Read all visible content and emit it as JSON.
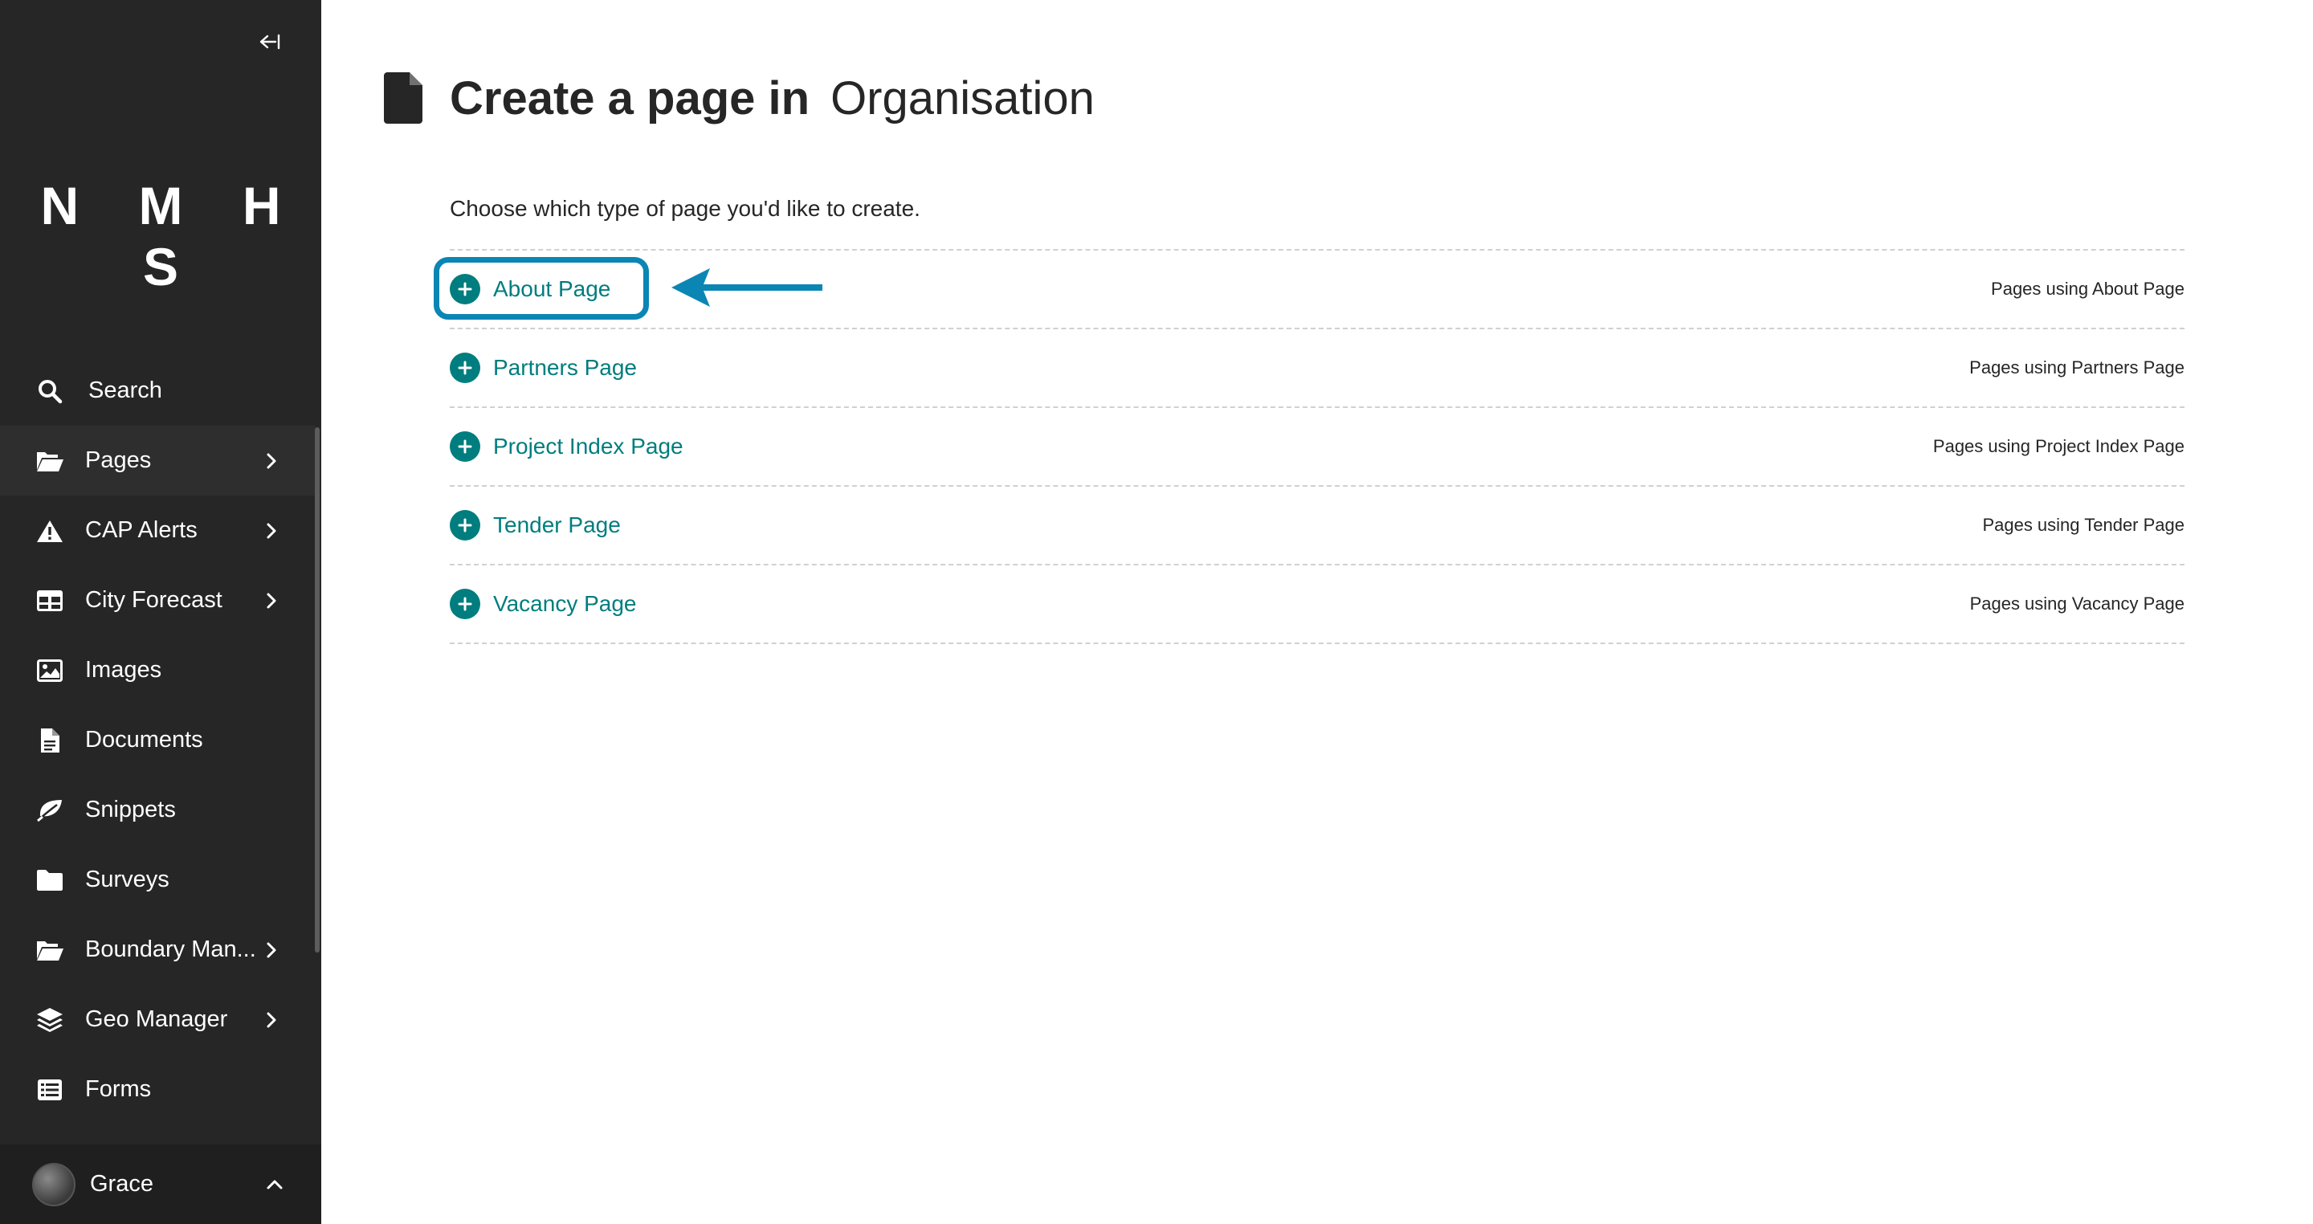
{
  "sidebar": {
    "logo": "N M H S",
    "nav": [
      {
        "label": "Search",
        "icon": "search-icon",
        "has_submenu": false
      },
      {
        "label": "Pages",
        "icon": "folder-open-icon",
        "has_submenu": true,
        "active": true
      },
      {
        "label": "CAP Alerts",
        "icon": "warning-icon",
        "has_submenu": true
      },
      {
        "label": "City Forecast",
        "icon": "table-icon",
        "has_submenu": true
      },
      {
        "label": "Images",
        "icon": "image-icon",
        "has_submenu": false
      },
      {
        "label": "Documents",
        "icon": "document-icon",
        "has_submenu": false
      },
      {
        "label": "Snippets",
        "icon": "leaf-icon",
        "has_submenu": false
      },
      {
        "label": "Surveys",
        "icon": "folder-icon",
        "has_submenu": false
      },
      {
        "label": "Boundary Man...",
        "icon": "folder-open-icon",
        "has_submenu": true
      },
      {
        "label": "Geo Manager",
        "icon": "layers-icon",
        "has_submenu": true
      },
      {
        "label": "Forms",
        "icon": "list-icon",
        "has_submenu": false
      }
    ],
    "account": {
      "name": "Grace"
    }
  },
  "header": {
    "title_bold": "Create a page in",
    "title_parent": "Organisation",
    "icon": "document-icon"
  },
  "main": {
    "intro": "Choose which type of page you'd like to create.",
    "page_types": [
      {
        "label": "About Page",
        "usage": "Pages using About Page",
        "highlighted": true
      },
      {
        "label": "Partners Page",
        "usage": "Pages using Partners Page"
      },
      {
        "label": "Project Index Page",
        "usage": "Pages using Project Index Page"
      },
      {
        "label": "Tender Page",
        "usage": "Pages using Tender Page"
      },
      {
        "label": "Vacancy Page",
        "usage": "Pages using Vacancy Page"
      }
    ]
  },
  "colors": {
    "sidebar_bg": "#262626",
    "accent_teal": "#007d7e",
    "annotation_blue": "#0b86b4"
  }
}
